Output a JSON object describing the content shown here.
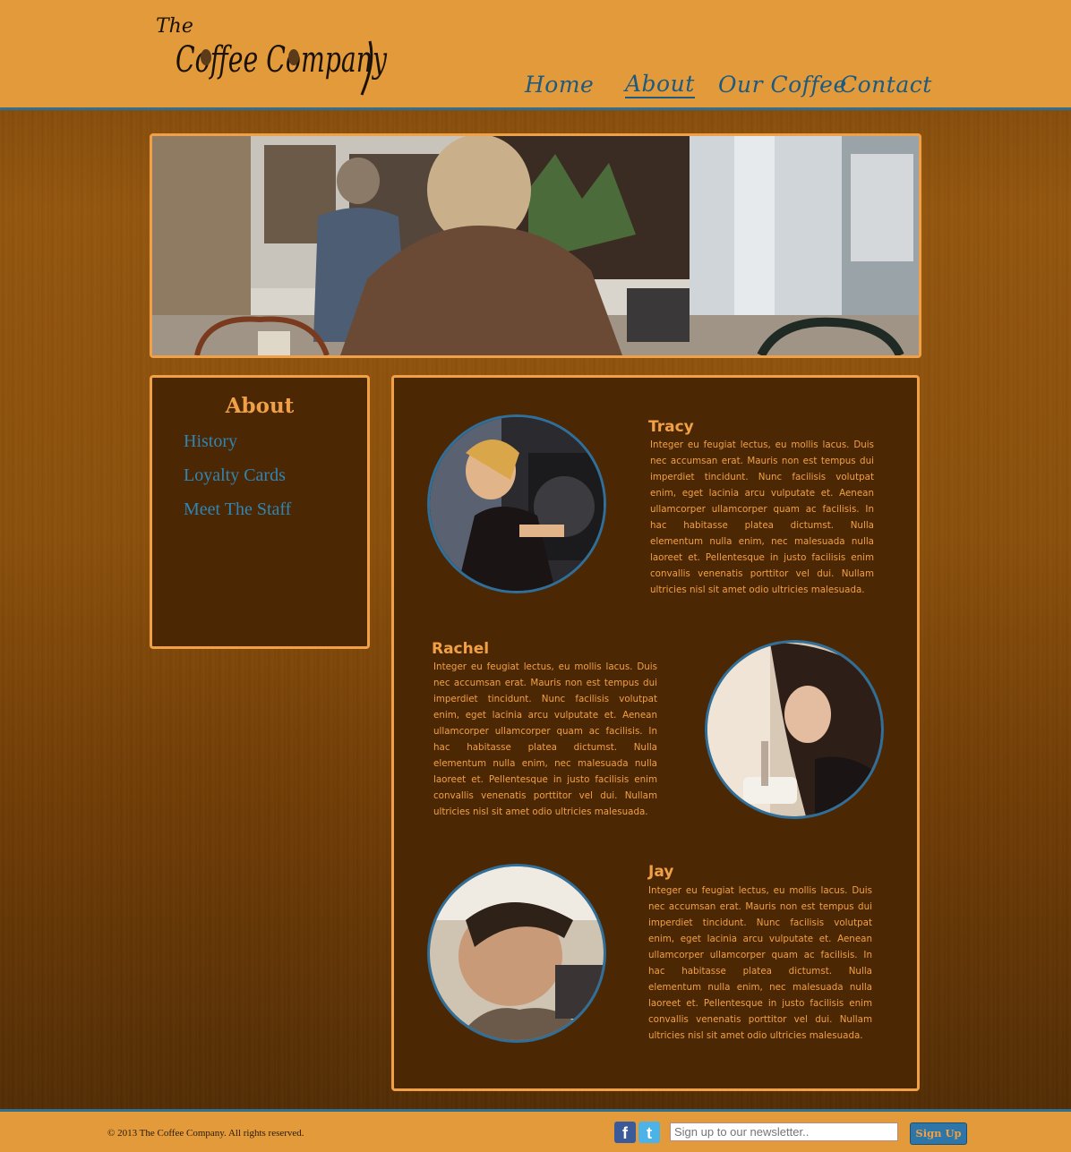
{
  "brand": {
    "logo_text_top": "The",
    "logo_text_main": "Coffee Company"
  },
  "nav": {
    "items": [
      {
        "label": "Home",
        "active": false
      },
      {
        "label": "About",
        "active": true
      },
      {
        "label": "Our Coffee",
        "active": false
      },
      {
        "label": "Contact",
        "active": false
      }
    ]
  },
  "sidebar": {
    "title": "About",
    "links": [
      "History",
      "Loyalty Cards",
      "Meet The Staff"
    ]
  },
  "staff": [
    {
      "name": "Tracy",
      "bio": "Integer eu feugiat lectus, eu mollis lacus. Duis nec accumsan erat. Mauris non est tempus dui imperdiet tincidunt. Nunc facilisis volutpat enim, eget lacinia arcu vulputate et. Aenean ullamcorper ullamcorper quam ac facilisis. In hac habitasse platea dictumst. Nulla elementum nulla enim, nec malesuada nulla laoreet et. Pellentesque in justo facilisis enim convallis venenatis porttitor vel dui. Nullam ultricies nisl sit amet odio ultricies malesuada."
    },
    {
      "name": "Rachel",
      "bio": "Integer eu feugiat lectus, eu mollis lacus. Duis nec accumsan erat. Mauris non est tempus dui imperdiet tincidunt. Nunc facilisis volutpat enim, eget lacinia arcu vulputate et. Aenean ullamcorper ullamcorper quam ac facilisis. In hac habitasse platea dictumst. Nulla elementum nulla enim, nec malesuada nulla laoreet et. Pellentesque in justo facilisis enim convallis venenatis porttitor vel dui. Nullam ultricies nisl sit amet odio ultricies malesuada."
    },
    {
      "name": "Jay",
      "bio": "Integer eu feugiat lectus, eu mollis lacus. Duis nec accumsan erat. Mauris non est tempus dui imperdiet tincidunt. Nunc facilisis volutpat enim, eget lacinia arcu vulputate et. Aenean ullamcorper ullamcorper quam ac facilisis. In hac habitasse platea dictumst. Nulla elementum nulla enim, nec malesuada nulla laoreet et. Pellentesque in justo facilisis enim convallis venenatis porttitor vel dui. Nullam ultricies nisl sit amet odio ultricies malesuada."
    }
  ],
  "footer": {
    "copyright": "© 2013 The Coffee Company. All rights reserved.",
    "newsletter_placeholder": "Sign up to our newsletter..",
    "signup_label": "Sign Up",
    "social": [
      "facebook-icon",
      "twitter-icon"
    ]
  },
  "colors": {
    "header": "#e29a3b",
    "accent_orange": "#f0a046",
    "accent_blue": "#2f6f8f",
    "panel": "#4c2703"
  }
}
